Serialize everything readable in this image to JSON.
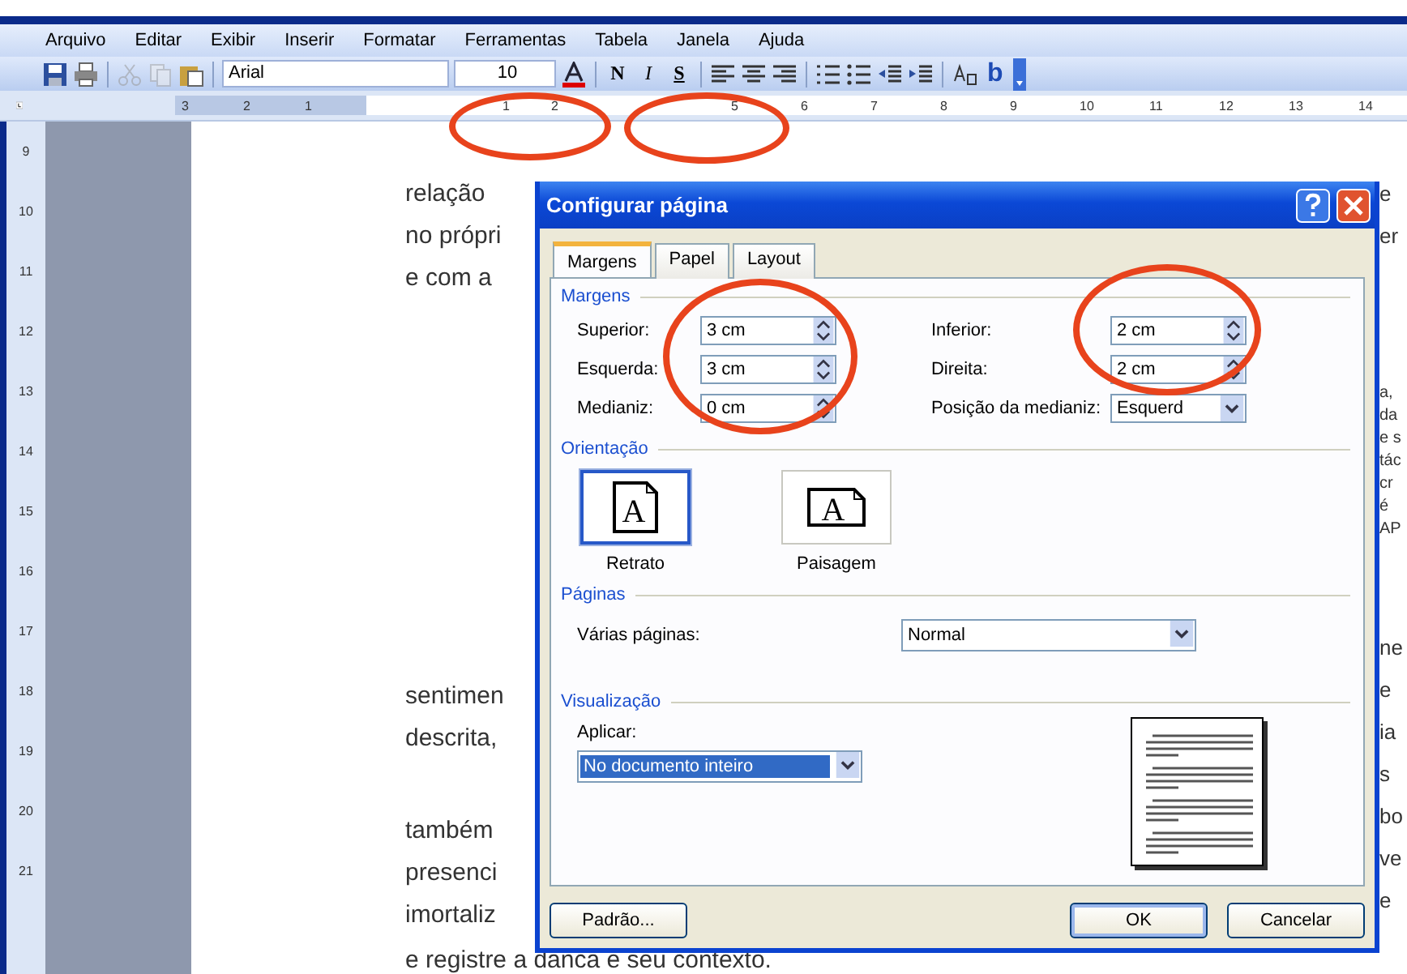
{
  "menu": [
    "Arquivo",
    "Editar",
    "Exibir",
    "Inserir",
    "Formatar",
    "Ferramentas",
    "Tabela",
    "Janela",
    "Ajuda"
  ],
  "toolbar": {
    "font": "Arial",
    "size": "10",
    "format_buttons": [
      {
        "label": "N",
        "kind": "bold"
      },
      {
        "label": "I",
        "kind": "italic"
      },
      {
        "label": "S",
        "kind": "underline"
      }
    ],
    "b_label": "b"
  },
  "ruler": {
    "segments": [
      {
        "kind": "margin",
        "labels": [
          "3",
          "2",
          "1"
        ]
      },
      {
        "kind": "text",
        "labels": [
          "1",
          "2"
        ]
      },
      {
        "kind": "marker"
      },
      {
        "kind": "text",
        "labels": [
          "5",
          "6",
          "7",
          "8",
          "9",
          "10",
          "11",
          "12",
          "13",
          "14"
        ]
      }
    ]
  },
  "vertical_ruler": [
    "9",
    "10",
    "11",
    "12",
    "13",
    "14",
    "15",
    "16",
    "17",
    "18",
    "19",
    "20",
    "21"
  ],
  "document": {
    "lines_top": [
      "relação",
      "no própri",
      "e com a"
    ],
    "lines_middle": [
      "sentimen",
      "descrita,"
    ],
    "lines_bottom": [
      "também",
      "presenci",
      "imortaliz"
    ],
    "last_line": "e registre a danca e seu contexto.",
    "right_fragments": [
      [
        "e",
        "er"
      ],
      [
        "a,",
        "da",
        "e s",
        "tác",
        "cr",
        "é",
        "AP"
      ],
      [
        "ne",
        "e",
        "ia",
        "s",
        "bo",
        "ve",
        "e"
      ]
    ]
  },
  "dialog": {
    "title": "Configurar página",
    "tabs": [
      {
        "label": "Margens",
        "selected": true
      },
      {
        "label": "Papel",
        "selected": false
      },
      {
        "label": "Layout",
        "selected": false
      }
    ],
    "margins": {
      "title": "Margens",
      "left": [
        {
          "label": "Superior:",
          "value": "3 cm"
        },
        {
          "label": "Esquerda:",
          "value": "3 cm"
        },
        {
          "label": "Medianiz:",
          "value": "0 cm"
        }
      ],
      "right": [
        {
          "label": "Inferior:",
          "value": "2 cm",
          "kind": "spin"
        },
        {
          "label": "Direita:",
          "value": "2 cm",
          "kind": "spin"
        },
        {
          "label": "Posição da medianiz:",
          "value": "Esquerd",
          "kind": "select"
        }
      ]
    },
    "orientation": {
      "title": "Orientação",
      "options": [
        {
          "label": "Retrato",
          "kind": "portrait",
          "glyph": "A",
          "selected": true
        },
        {
          "label": "Paisagem",
          "kind": "landscape",
          "glyph": "A",
          "selected": false
        }
      ]
    },
    "pages": {
      "title": "Páginas",
      "label": "Várias páginas:",
      "value": "Normal"
    },
    "preview": {
      "title": "Visualização",
      "apply_label": "Aplicar:",
      "apply_value": "No documento inteiro",
      "highlighted": true
    },
    "buttons": [
      {
        "label": "Padrão...",
        "kind": "left"
      },
      {
        "label": "OK",
        "kind": "default"
      },
      {
        "label": "Cancelar",
        "kind": "right"
      }
    ]
  }
}
